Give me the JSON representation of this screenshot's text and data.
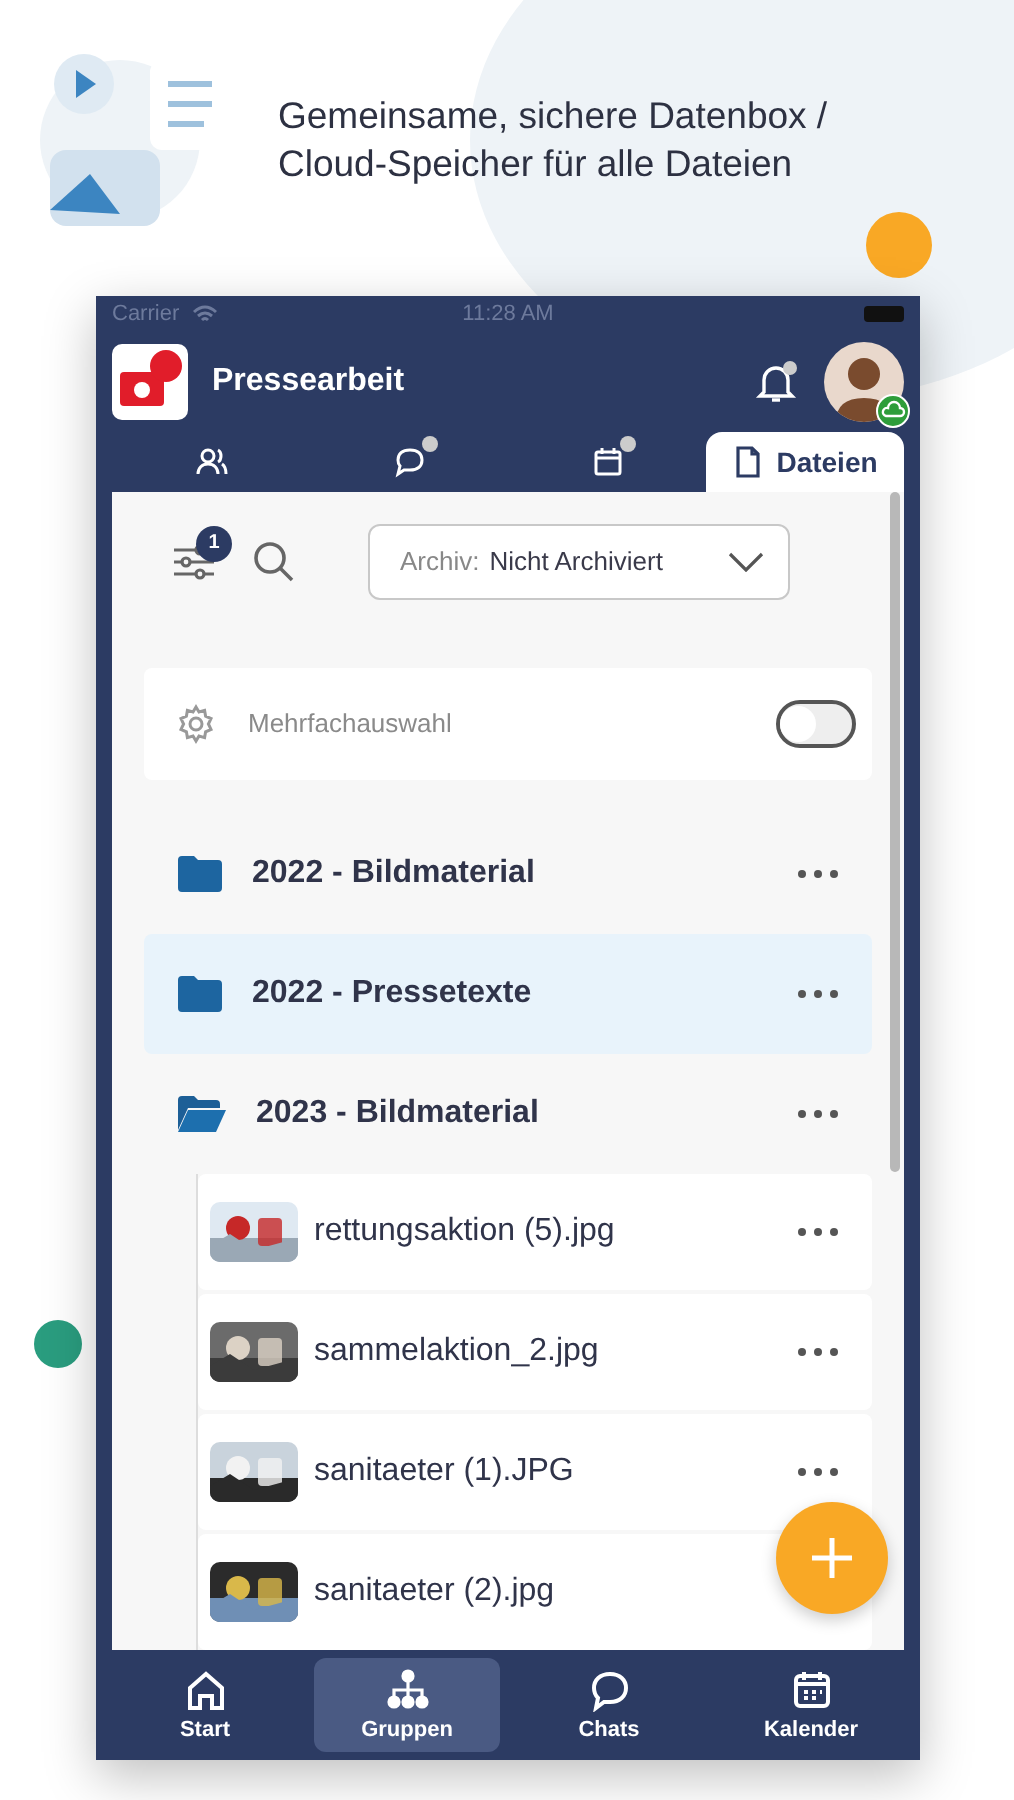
{
  "caption": "Gemeinsame, sichere Datenbox / Cloud-Speicher für alle Dateien",
  "status_bar": {
    "carrier": "Carrier",
    "time": "11:28 AM"
  },
  "header": {
    "title": "Pressearbeit",
    "notification_dot": true
  },
  "tabs": [
    {
      "kind": "members",
      "selected": false,
      "dot": false
    },
    {
      "kind": "chat",
      "selected": false,
      "dot": true
    },
    {
      "kind": "calendar",
      "selected": false,
      "dot": true
    },
    {
      "kind": "files",
      "label": "Dateien",
      "selected": true,
      "dot": false
    }
  ],
  "toolbar": {
    "filter_count": "1",
    "archive_label": "Archiv:",
    "archive_value": "Nicht Archiviert"
  },
  "multi_select": {
    "label": "Mehrfachauswahl",
    "on": false
  },
  "folders": [
    {
      "name": "2022 - Bildmaterial",
      "selected": false,
      "expanded": false
    },
    {
      "name": "2022 - Pressetexte",
      "selected": true,
      "expanded": false
    },
    {
      "name": "2023 - Bildmaterial",
      "selected": false,
      "expanded": true,
      "children": [
        {
          "name": "rettungsaktion (5).jpg",
          "kind": "picture"
        },
        {
          "name": "sammelaktion_2.jpg",
          "kind": "picture"
        },
        {
          "name": "sanitaeter (1).JPG",
          "kind": "picture"
        },
        {
          "name": "sanitaeter (2).jpg",
          "kind": "picture"
        }
      ]
    }
  ],
  "bottom_nav": [
    {
      "kind": "home",
      "label": "Start",
      "selected": false
    },
    {
      "kind": "groups",
      "label": "Gruppen",
      "selected": true
    },
    {
      "kind": "chats",
      "label": "Chats",
      "selected": false
    },
    {
      "kind": "calendar",
      "label": "Kalender",
      "selected": false
    }
  ]
}
